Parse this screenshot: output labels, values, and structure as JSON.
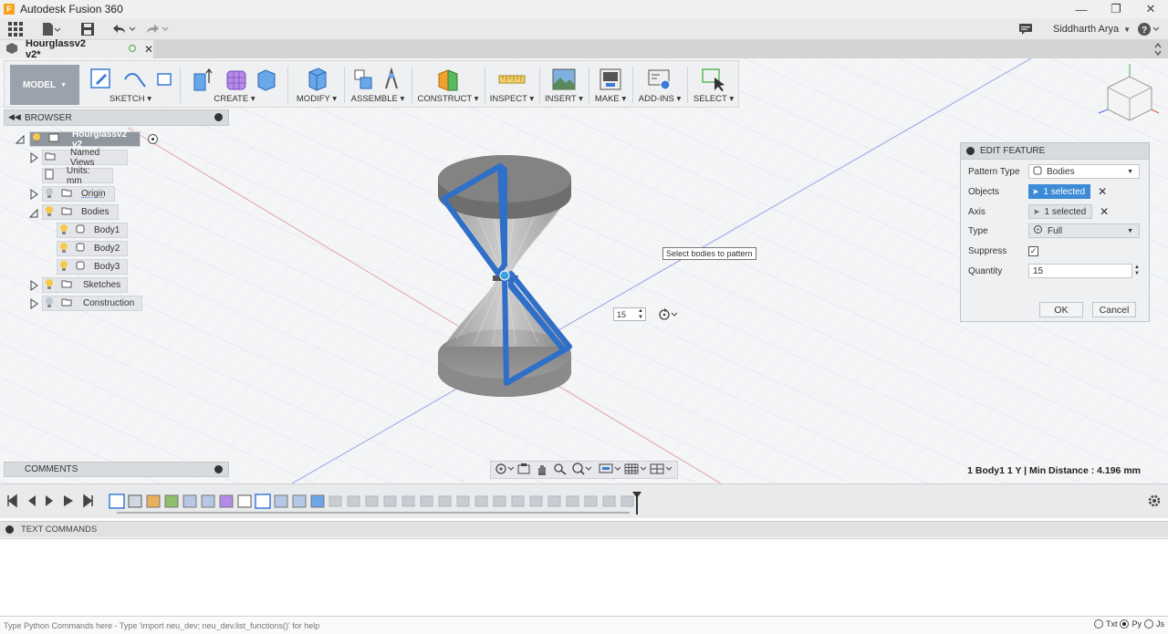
{
  "window": {
    "title": "Autodesk Fusion 360",
    "logo": "F"
  },
  "quick_access": {
    "user_name": "Siddharth Arya"
  },
  "document_tab": {
    "label": "Hourglassv2 v2*"
  },
  "toolbar": {
    "mode": "MODEL",
    "groups": [
      {
        "label": "SKETCH"
      },
      {
        "label": "CREATE"
      },
      {
        "label": "MODIFY"
      },
      {
        "label": "ASSEMBLE"
      },
      {
        "label": "CONSTRUCT"
      },
      {
        "label": "INSPECT"
      },
      {
        "label": "INSERT"
      },
      {
        "label": "MAKE"
      },
      {
        "label": "ADD-INS"
      },
      {
        "label": "SELECT"
      }
    ]
  },
  "browser": {
    "title": "BROWSER",
    "root": "Hourglassv2 v2",
    "items": [
      {
        "label": "Named Views"
      },
      {
        "label": "Units: mm"
      },
      {
        "label": "Origin"
      },
      {
        "label": "Bodies"
      },
      {
        "label": "Body1"
      },
      {
        "label": "Body2"
      },
      {
        "label": "Body3"
      },
      {
        "label": "Sketches"
      },
      {
        "label": "Construction"
      }
    ]
  },
  "comments": {
    "title": "COMMENTS"
  },
  "tooltip": {
    "text": "Select bodies to pattern"
  },
  "mini_input": {
    "value": "15"
  },
  "dialog": {
    "title": "EDIT FEATURE",
    "pattern_type_label": "Pattern Type",
    "pattern_type_value": "Bodies",
    "objects_label": "Objects",
    "objects_value": "1 selected",
    "axis_label": "Axis",
    "axis_value": "1 selected",
    "type_label": "Type",
    "type_value": "Full",
    "suppress_label": "Suppress",
    "quantity_label": "Quantity",
    "quantity_value": "15",
    "ok": "OK",
    "cancel": "Cancel"
  },
  "status": {
    "measure": "1 Body1 1 Y | Min Distance : 4.196 mm"
  },
  "text_commands": {
    "title": "TEXT COMMANDS",
    "placeholder": "Type Python Commands here - Type 'import neu_dev; neu_dev.list_functions()' for help",
    "options": [
      "Txt",
      "Py",
      "Js"
    ]
  },
  "colors": {
    "accent": "#3d8ad6",
    "body_highlight": "#2f6fc7"
  }
}
